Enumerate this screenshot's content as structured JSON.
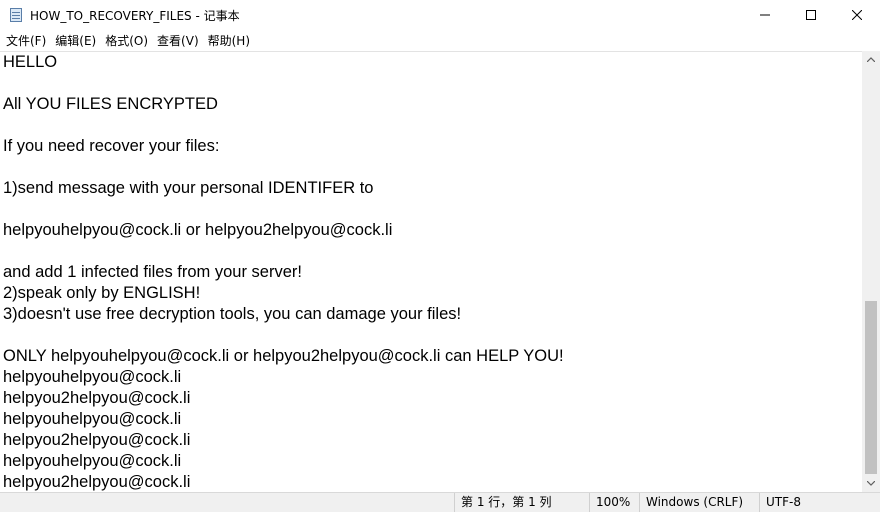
{
  "window": {
    "title": "HOW_TO_RECOVERY_FILES - 记事本",
    "app_icon": "notepad-icon",
    "controls": [
      "minimize-icon",
      "maximize-icon",
      "close-icon"
    ]
  },
  "menu": {
    "items": [
      "文件(F)",
      "编辑(E)",
      "格式(O)",
      "查看(V)",
      "帮助(H)"
    ]
  },
  "editor": {
    "lines": [
      "HELLO",
      "",
      "All YOU FILES ENCRYPTED",
      "",
      "If you need recover your files:",
      "",
      "1)send message with your personal IDENTIFER to",
      "",
      "helpyouhelpyou@cock.li or helpyou2helpyou@cock.li",
      "",
      "and add 1 infected files from your server!",
      "2)speak only by ENGLISH!",
      "3)doesn't use free decryption tools, you can damage your files!",
      "",
      "ONLY helpyouhelpyou@cock.li or helpyou2helpyou@cock.li can HELP YOU!",
      "helpyouhelpyou@cock.li",
      "helpyou2helpyou@cock.li",
      "helpyouhelpyou@cock.li",
      "helpyou2helpyou@cock.li",
      "helpyouhelpyou@cock.li",
      "helpyou2helpyou@cock.li"
    ]
  },
  "status": {
    "position": "第 1 行，第 1 列",
    "zoom": "100%",
    "line_ending": "Windows (CRLF)",
    "encoding": "UTF-8"
  }
}
